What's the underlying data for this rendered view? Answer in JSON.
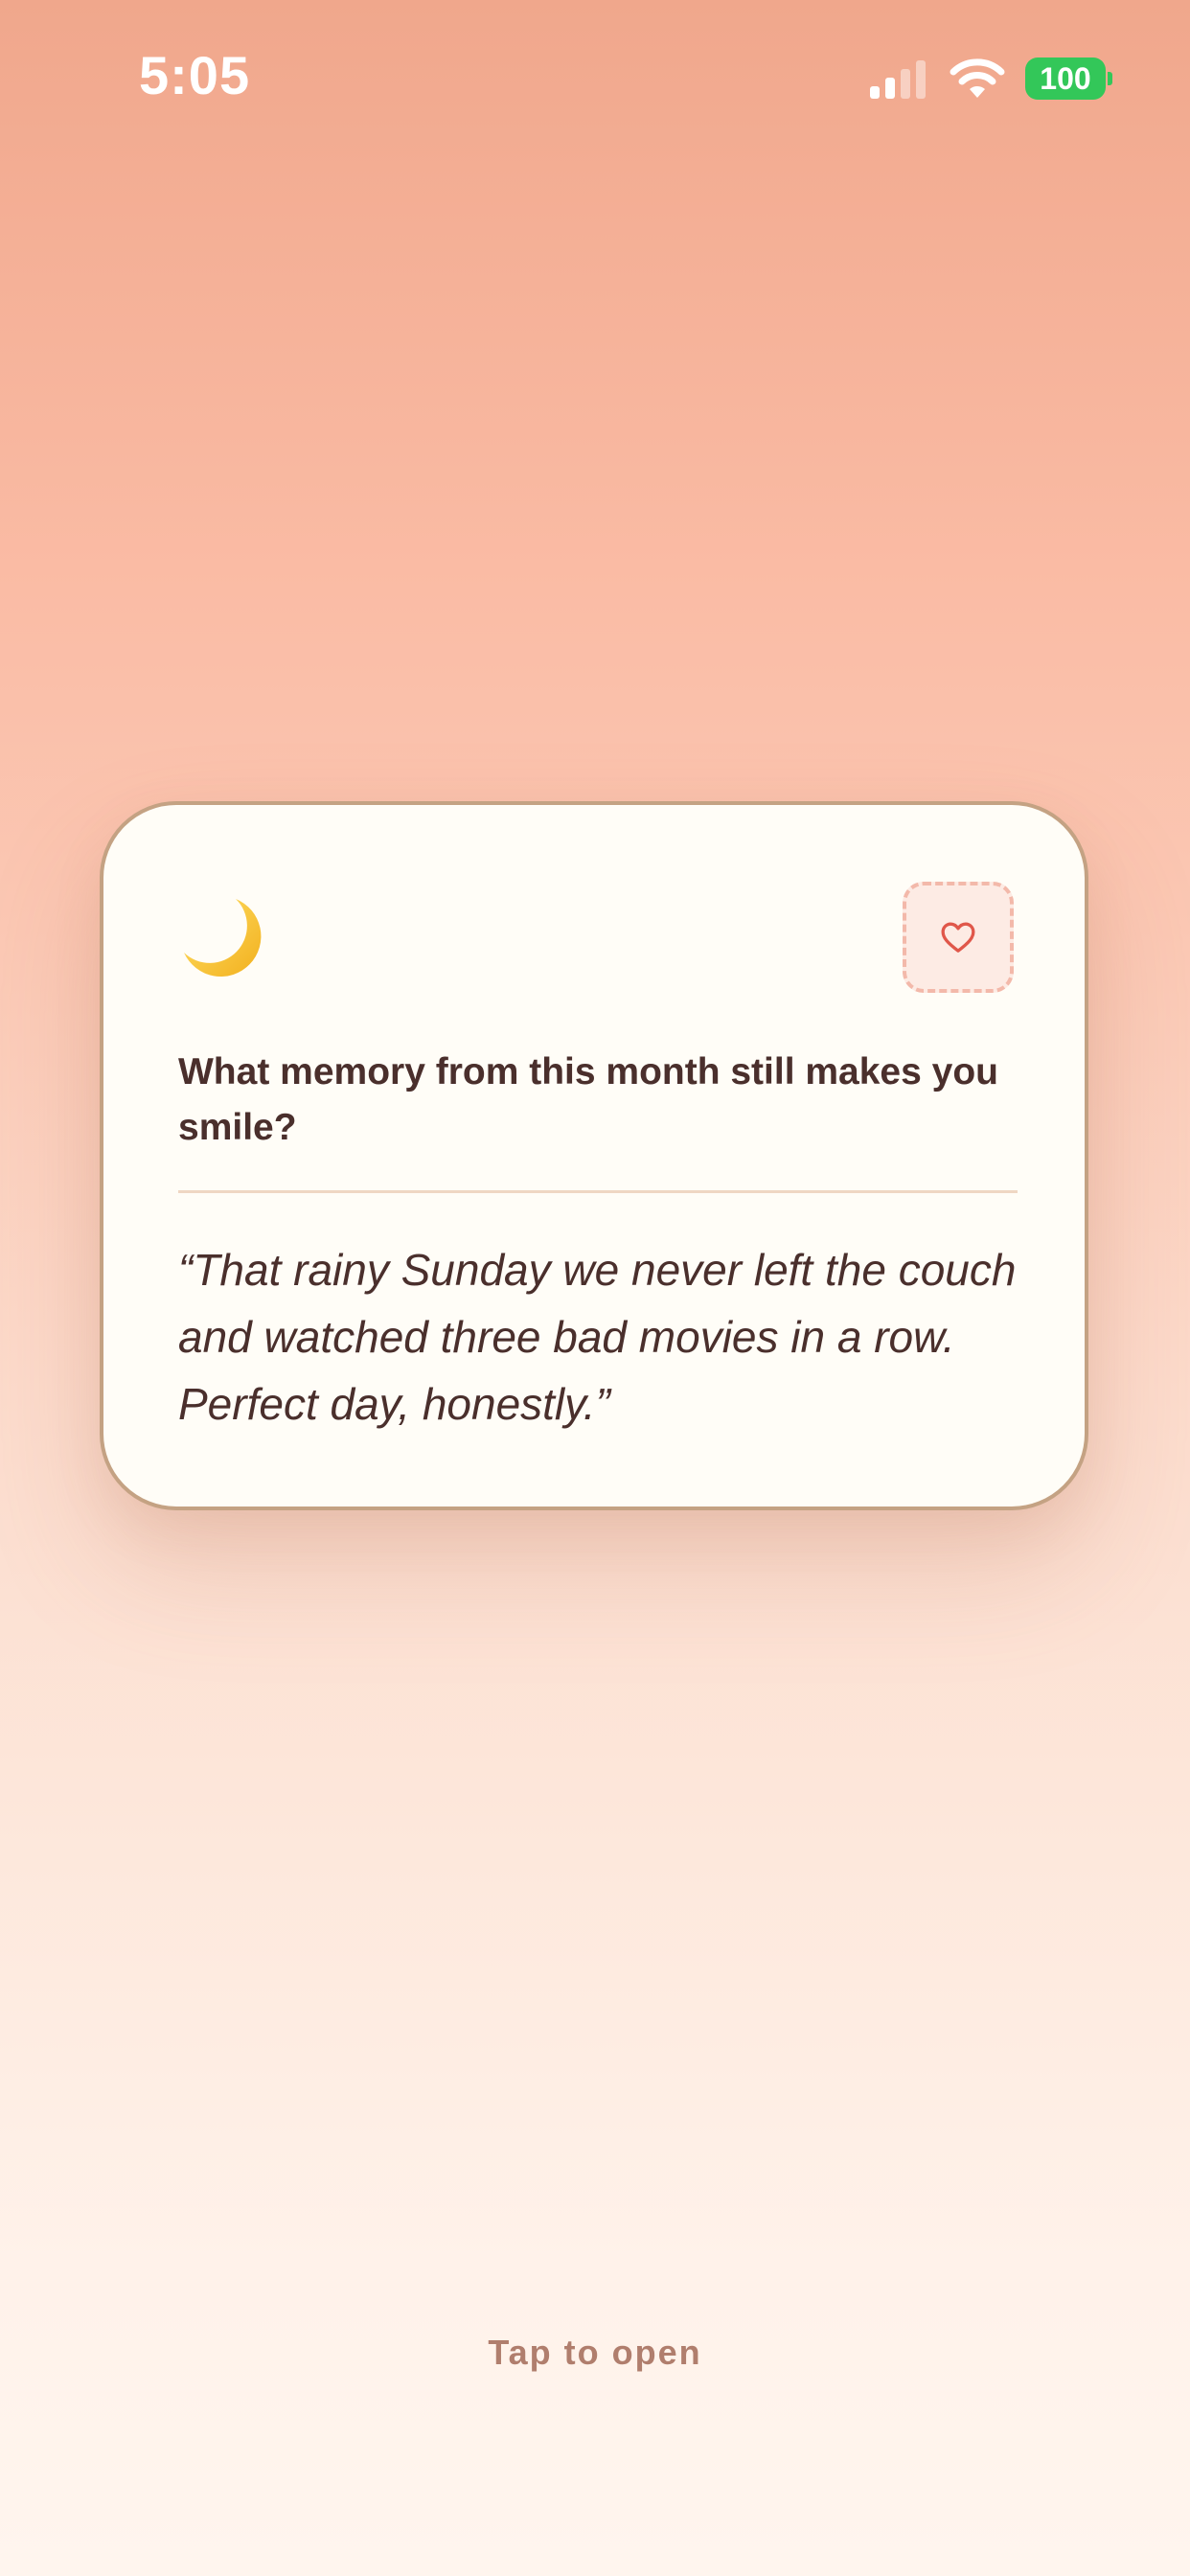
{
  "status_bar": {
    "time": "5:05",
    "battery_level": "100",
    "signal_icon": "cellular-signal-icon",
    "wifi_icon": "wifi-icon"
  },
  "card": {
    "emoji_icon": "crescent-moon-icon",
    "favorite_icon": "heart-outline-icon",
    "prompt": "What memory from this month still makes you smile?",
    "answer": "“That rainy Sunday we never left the couch and watched three bad movies in a row. Perfect day, honestly.”"
  },
  "footer": {
    "hint": "Tap to open"
  },
  "colors": {
    "accent_heart": "#e0574a",
    "battery": "#33c759",
    "text": "#4a2f2c",
    "card_border": "#c4a283",
    "hint_text": "#b07e6d"
  }
}
